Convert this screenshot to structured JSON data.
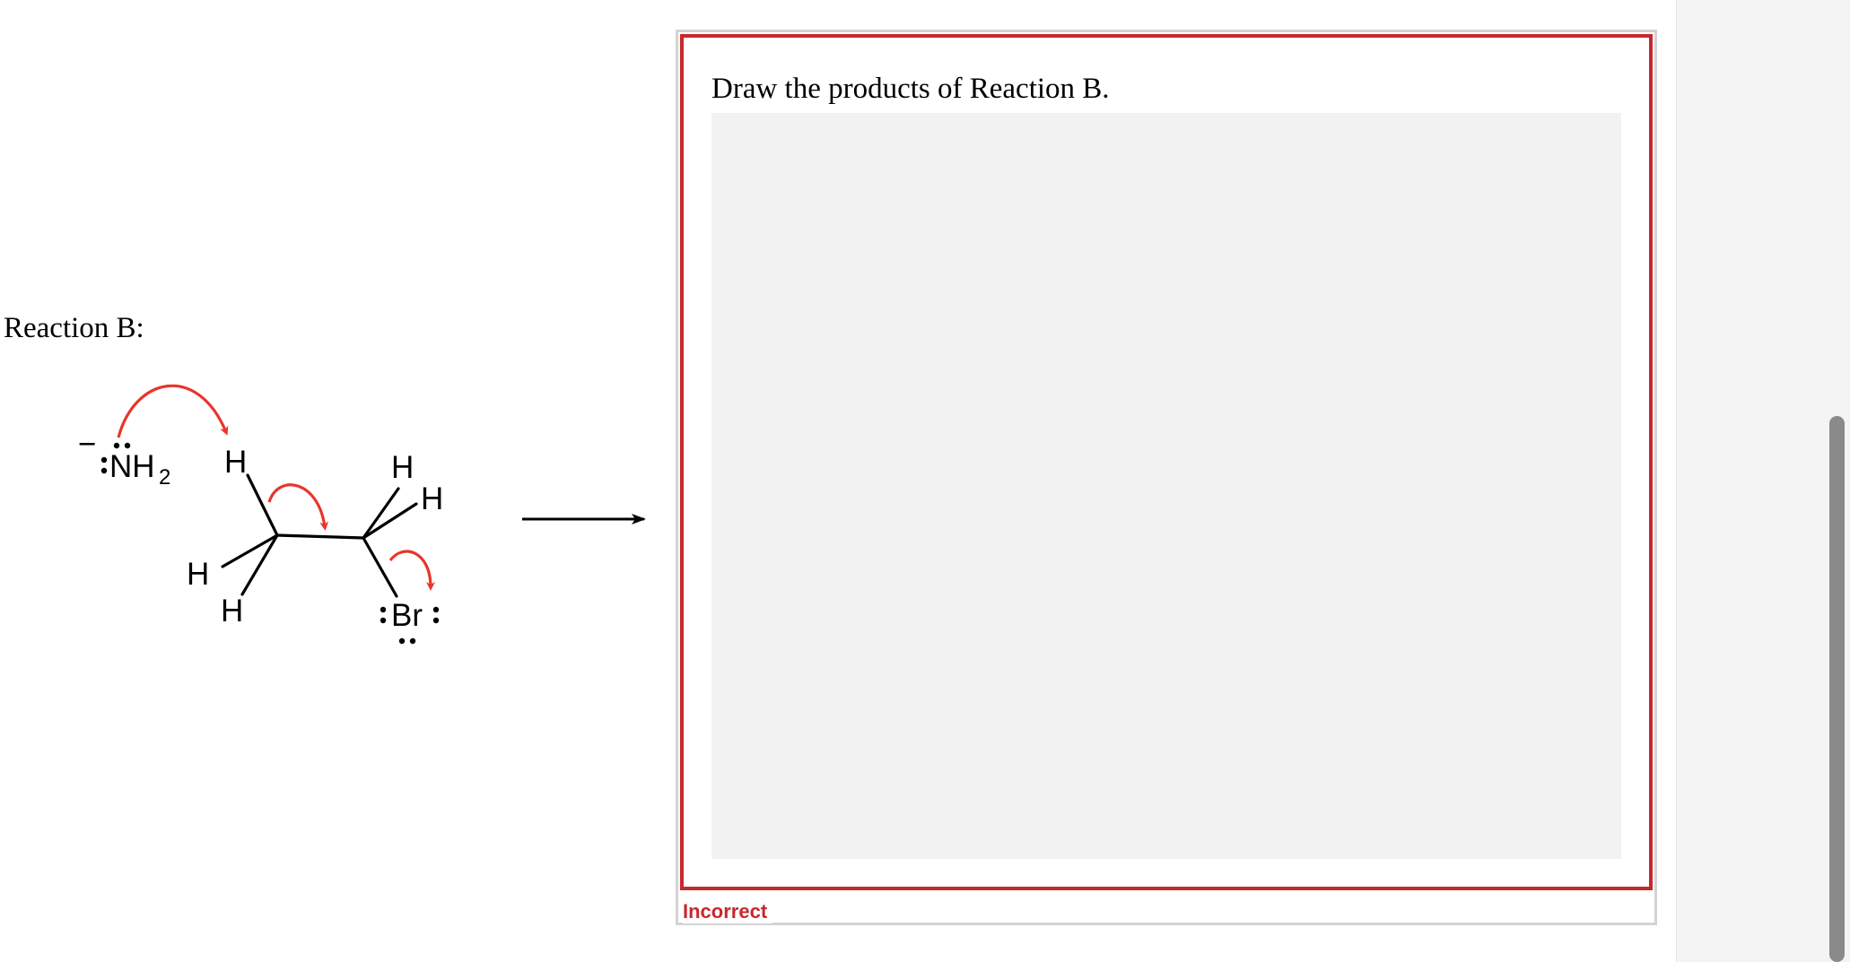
{
  "reaction": {
    "label": "Reaction B:",
    "nucleophile": {
      "atom": "NH",
      "subscript": "2",
      "charge": "−"
    },
    "hydrogen": "H",
    "leaving_group": "Br",
    "arrow_color": "#e8352b"
  },
  "question": {
    "prompt": "Draw the products of Reaction B.",
    "status": "Incorrect",
    "status_color": "#c7282c"
  }
}
